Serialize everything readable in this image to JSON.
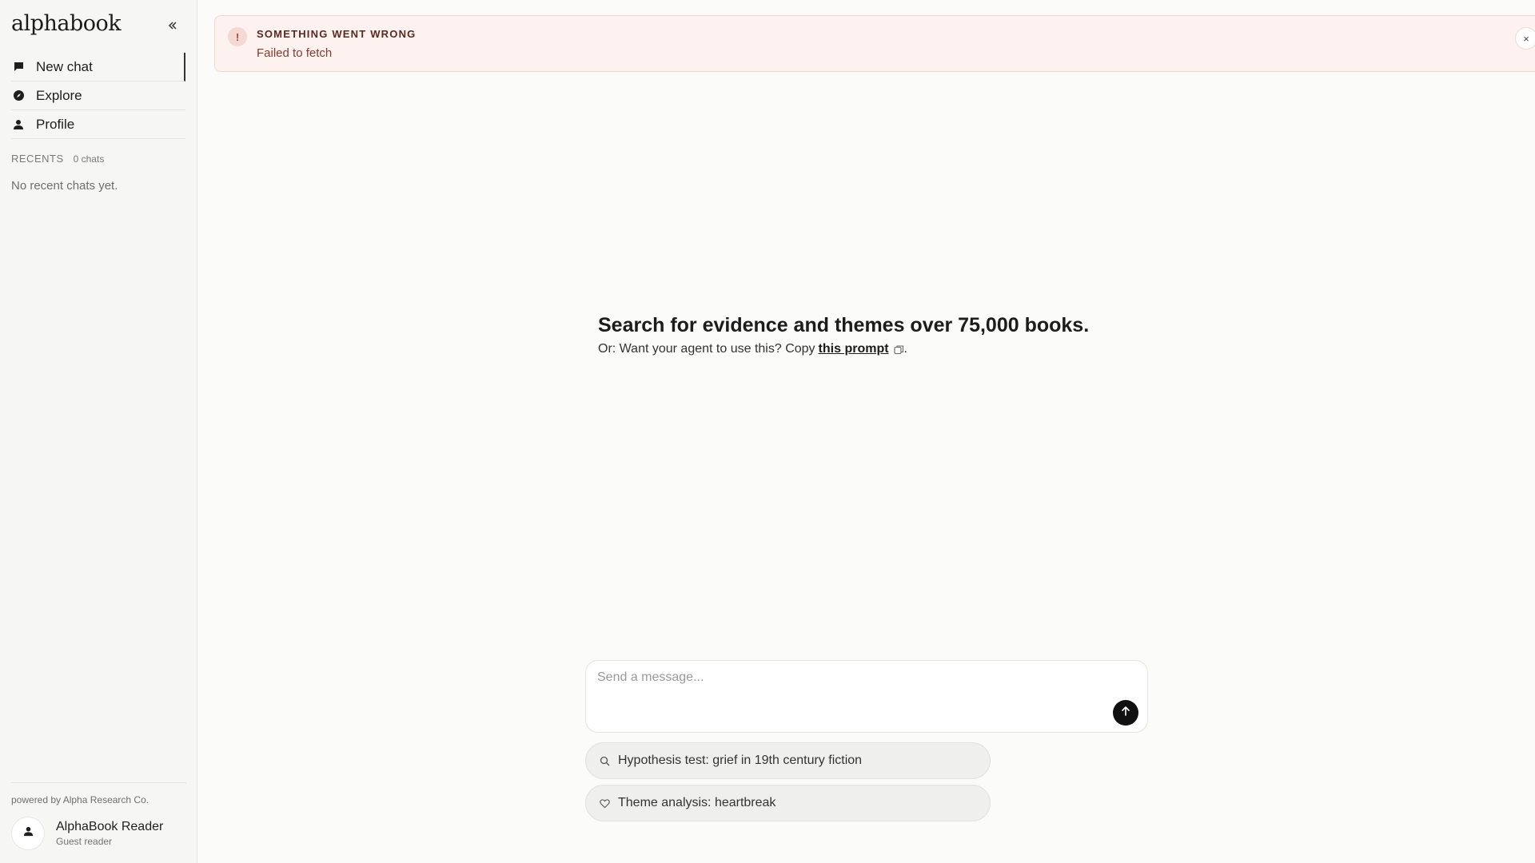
{
  "sidebar": {
    "brand": "alphabook",
    "collapse_icon": "double-chevron-left-icon",
    "nav": [
      {
        "label": "New chat",
        "icon": "chat-bubble-icon",
        "active": true
      },
      {
        "label": "Explore",
        "icon": "compass-icon"
      },
      {
        "label": "Profile",
        "icon": "person-icon"
      }
    ],
    "recents": {
      "title": "RECENTS",
      "count": "0 chats",
      "empty": "No recent chats yet."
    },
    "powered_by": "powered by Alpha Research Co.",
    "user": {
      "name": "AlphaBook Reader",
      "role": "Guest reader",
      "icon": "person-icon"
    }
  },
  "banner": {
    "icon": "!",
    "title": "SOMETHING WENT WRONG",
    "message": "Failed to fetch",
    "close": "×"
  },
  "hero": {
    "title": "Search for evidence and themes over 75,000 books.",
    "sub_prefix": "Or: Want your agent to use this? Copy",
    "prompt_link": "this prompt",
    "sub_suffix": "."
  },
  "composer": {
    "placeholder": "Send a message...",
    "send_icon": "arrow-up-icon"
  },
  "suggestions": [
    {
      "label": "Hypothesis test: grief in 19th century fiction",
      "icon": "search-icon"
    },
    {
      "label": "Theme analysis: heartbreak",
      "icon": "heart-icon"
    }
  ],
  "colors": {
    "banner_bg": "#fdf2ef",
    "banner_text": "#8a3a2c",
    "send_button": "#111111"
  }
}
